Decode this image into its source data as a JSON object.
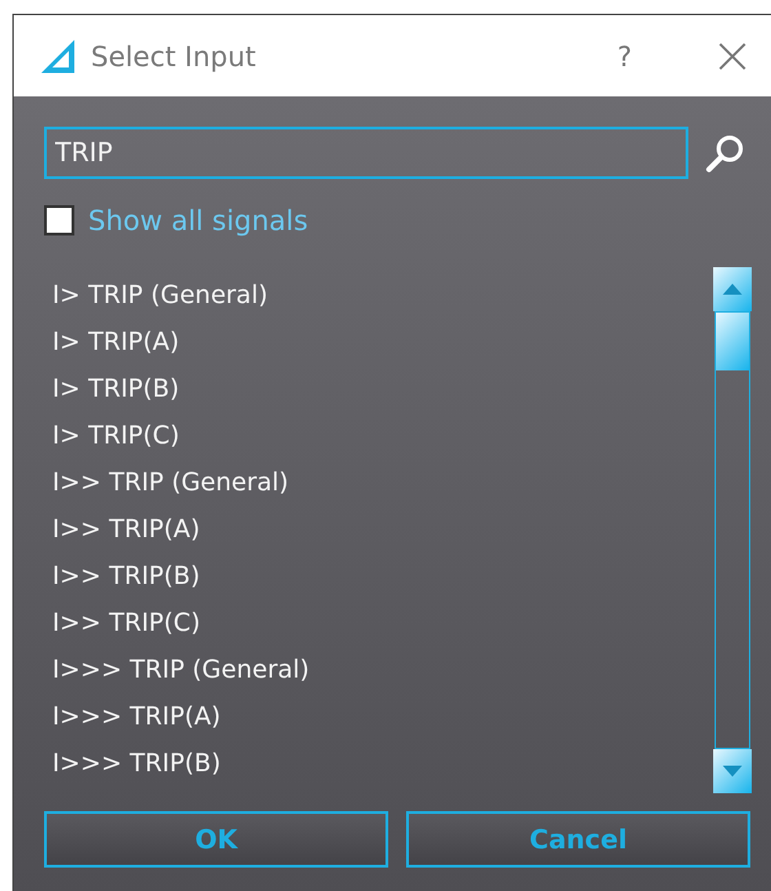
{
  "window": {
    "title": "Select Input",
    "help": "?"
  },
  "search": {
    "value": "TRIP"
  },
  "show_all": {
    "label": "Show all signals",
    "checked": false
  },
  "items": [
    {
      "label": "I> TRIP (General)",
      "selected": false
    },
    {
      "label": "I> TRIP(A)",
      "selected": false
    },
    {
      "label": "I> TRIP(B)",
      "selected": false
    },
    {
      "label": "I> TRIP(C)",
      "selected": false
    },
    {
      "label": "I>> TRIP (General)",
      "selected": false
    },
    {
      "label": "I>> TRIP(A)",
      "selected": false
    },
    {
      "label": "I>> TRIP(B)",
      "selected": false
    },
    {
      "label": "I>> TRIP(C)",
      "selected": false
    },
    {
      "label": "I>>> TRIP (General)",
      "selected": false
    },
    {
      "label": "I>>> TRIP(A)",
      "selected": false
    },
    {
      "label": "I>>> TRIP(B)",
      "selected": false
    }
  ],
  "buttons": [
    "OK",
    "Cancel"
  ]
}
